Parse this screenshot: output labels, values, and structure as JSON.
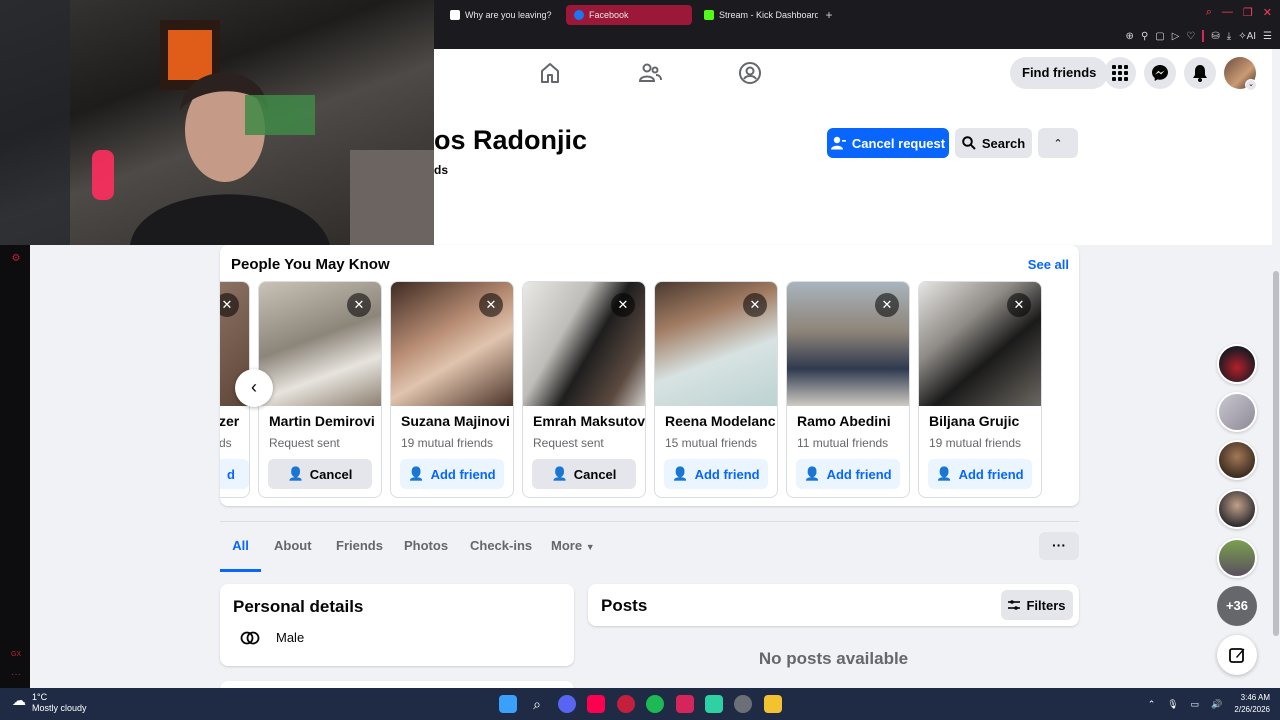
{
  "browser": {
    "tabs": [
      {
        "label": "Why are you leaving?",
        "active": false,
        "favicon": "video-icon"
      },
      {
        "label": "Facebook",
        "active": true,
        "favicon": "facebook-icon"
      },
      {
        "label": "Stream - Kick Dashboard",
        "active": false,
        "favicon": "kick-icon"
      }
    ],
    "new_tab": "+",
    "accent": "#ff3b5c"
  },
  "topbar": {
    "find_friends": "Find friends"
  },
  "profile": {
    "name": "os Radonjic",
    "friends": "ds",
    "cancel_request": "Cancel request",
    "search": "Search"
  },
  "pymk": {
    "title": "People You May Know",
    "see_all": "See all",
    "partial_left": {
      "name": "zer",
      "sub": "ds",
      "button": "d"
    },
    "cards": [
      {
        "name": "Martin Demirovi",
        "sub": "Request sent",
        "button": "Cancel",
        "kind": "cancel"
      },
      {
        "name": "Suzana Majinovi",
        "sub": "19 mutual friends",
        "button": "Add friend",
        "kind": "add"
      },
      {
        "name": "Emrah Maksutov",
        "sub": "Request sent",
        "button": "Cancel",
        "kind": "cancel"
      },
      {
        "name": "Reena Modelanc",
        "sub": "15 mutual friends",
        "button": "Add friend",
        "kind": "add"
      },
      {
        "name": "Ramo Abedini",
        "sub": "11 mutual friends",
        "button": "Add friend",
        "kind": "add"
      },
      {
        "name": "Biljana Grujic",
        "sub": "19 mutual friends",
        "button": "Add friend",
        "kind": "add"
      }
    ]
  },
  "tabs": {
    "items": [
      "All",
      "About",
      "Friends",
      "Photos",
      "Check-ins",
      "More"
    ],
    "active": "All",
    "more_dots": "···"
  },
  "personal": {
    "title": "Personal details",
    "gender": "Male"
  },
  "posts": {
    "title": "Posts",
    "filters": "Filters",
    "empty": "No posts available"
  },
  "contacts": {
    "more": "+36"
  },
  "taskbar": {
    "temp": "1°C",
    "weather": "Mostly cloudy",
    "time": "3:46 AM",
    "date": "2/26/2026"
  }
}
